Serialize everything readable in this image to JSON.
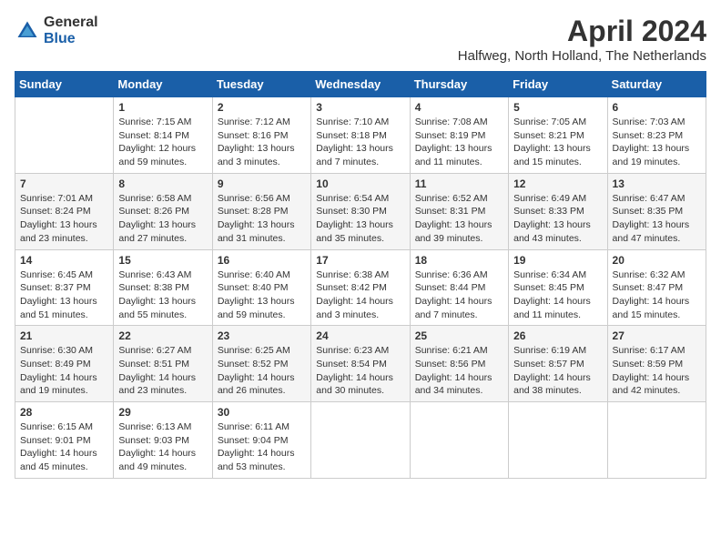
{
  "logo": {
    "general": "General",
    "blue": "Blue"
  },
  "title": "April 2024",
  "subtitle": "Halfweg, North Holland, The Netherlands",
  "headers": [
    "Sunday",
    "Monday",
    "Tuesday",
    "Wednesday",
    "Thursday",
    "Friday",
    "Saturday"
  ],
  "weeks": [
    [
      {
        "day": "",
        "content": ""
      },
      {
        "day": "1",
        "content": "Sunrise: 7:15 AM\nSunset: 8:14 PM\nDaylight: 12 hours\nand 59 minutes."
      },
      {
        "day": "2",
        "content": "Sunrise: 7:12 AM\nSunset: 8:16 PM\nDaylight: 13 hours\nand 3 minutes."
      },
      {
        "day": "3",
        "content": "Sunrise: 7:10 AM\nSunset: 8:18 PM\nDaylight: 13 hours\nand 7 minutes."
      },
      {
        "day": "4",
        "content": "Sunrise: 7:08 AM\nSunset: 8:19 PM\nDaylight: 13 hours\nand 11 minutes."
      },
      {
        "day": "5",
        "content": "Sunrise: 7:05 AM\nSunset: 8:21 PM\nDaylight: 13 hours\nand 15 minutes."
      },
      {
        "day": "6",
        "content": "Sunrise: 7:03 AM\nSunset: 8:23 PM\nDaylight: 13 hours\nand 19 minutes."
      }
    ],
    [
      {
        "day": "7",
        "content": "Sunrise: 7:01 AM\nSunset: 8:24 PM\nDaylight: 13 hours\nand 23 minutes."
      },
      {
        "day": "8",
        "content": "Sunrise: 6:58 AM\nSunset: 8:26 PM\nDaylight: 13 hours\nand 27 minutes."
      },
      {
        "day": "9",
        "content": "Sunrise: 6:56 AM\nSunset: 8:28 PM\nDaylight: 13 hours\nand 31 minutes."
      },
      {
        "day": "10",
        "content": "Sunrise: 6:54 AM\nSunset: 8:30 PM\nDaylight: 13 hours\nand 35 minutes."
      },
      {
        "day": "11",
        "content": "Sunrise: 6:52 AM\nSunset: 8:31 PM\nDaylight: 13 hours\nand 39 minutes."
      },
      {
        "day": "12",
        "content": "Sunrise: 6:49 AM\nSunset: 8:33 PM\nDaylight: 13 hours\nand 43 minutes."
      },
      {
        "day": "13",
        "content": "Sunrise: 6:47 AM\nSunset: 8:35 PM\nDaylight: 13 hours\nand 47 minutes."
      }
    ],
    [
      {
        "day": "14",
        "content": "Sunrise: 6:45 AM\nSunset: 8:37 PM\nDaylight: 13 hours\nand 51 minutes."
      },
      {
        "day": "15",
        "content": "Sunrise: 6:43 AM\nSunset: 8:38 PM\nDaylight: 13 hours\nand 55 minutes."
      },
      {
        "day": "16",
        "content": "Sunrise: 6:40 AM\nSunset: 8:40 PM\nDaylight: 13 hours\nand 59 minutes."
      },
      {
        "day": "17",
        "content": "Sunrise: 6:38 AM\nSunset: 8:42 PM\nDaylight: 14 hours\nand 3 minutes."
      },
      {
        "day": "18",
        "content": "Sunrise: 6:36 AM\nSunset: 8:44 PM\nDaylight: 14 hours\nand 7 minutes."
      },
      {
        "day": "19",
        "content": "Sunrise: 6:34 AM\nSunset: 8:45 PM\nDaylight: 14 hours\nand 11 minutes."
      },
      {
        "day": "20",
        "content": "Sunrise: 6:32 AM\nSunset: 8:47 PM\nDaylight: 14 hours\nand 15 minutes."
      }
    ],
    [
      {
        "day": "21",
        "content": "Sunrise: 6:30 AM\nSunset: 8:49 PM\nDaylight: 14 hours\nand 19 minutes."
      },
      {
        "day": "22",
        "content": "Sunrise: 6:27 AM\nSunset: 8:51 PM\nDaylight: 14 hours\nand 23 minutes."
      },
      {
        "day": "23",
        "content": "Sunrise: 6:25 AM\nSunset: 8:52 PM\nDaylight: 14 hours\nand 26 minutes."
      },
      {
        "day": "24",
        "content": "Sunrise: 6:23 AM\nSunset: 8:54 PM\nDaylight: 14 hours\nand 30 minutes."
      },
      {
        "day": "25",
        "content": "Sunrise: 6:21 AM\nSunset: 8:56 PM\nDaylight: 14 hours\nand 34 minutes."
      },
      {
        "day": "26",
        "content": "Sunrise: 6:19 AM\nSunset: 8:57 PM\nDaylight: 14 hours\nand 38 minutes."
      },
      {
        "day": "27",
        "content": "Sunrise: 6:17 AM\nSunset: 8:59 PM\nDaylight: 14 hours\nand 42 minutes."
      }
    ],
    [
      {
        "day": "28",
        "content": "Sunrise: 6:15 AM\nSunset: 9:01 PM\nDaylight: 14 hours\nand 45 minutes."
      },
      {
        "day": "29",
        "content": "Sunrise: 6:13 AM\nSunset: 9:03 PM\nDaylight: 14 hours\nand 49 minutes."
      },
      {
        "day": "30",
        "content": "Sunrise: 6:11 AM\nSunset: 9:04 PM\nDaylight: 14 hours\nand 53 minutes."
      },
      {
        "day": "",
        "content": ""
      },
      {
        "day": "",
        "content": ""
      },
      {
        "day": "",
        "content": ""
      },
      {
        "day": "",
        "content": ""
      }
    ]
  ]
}
